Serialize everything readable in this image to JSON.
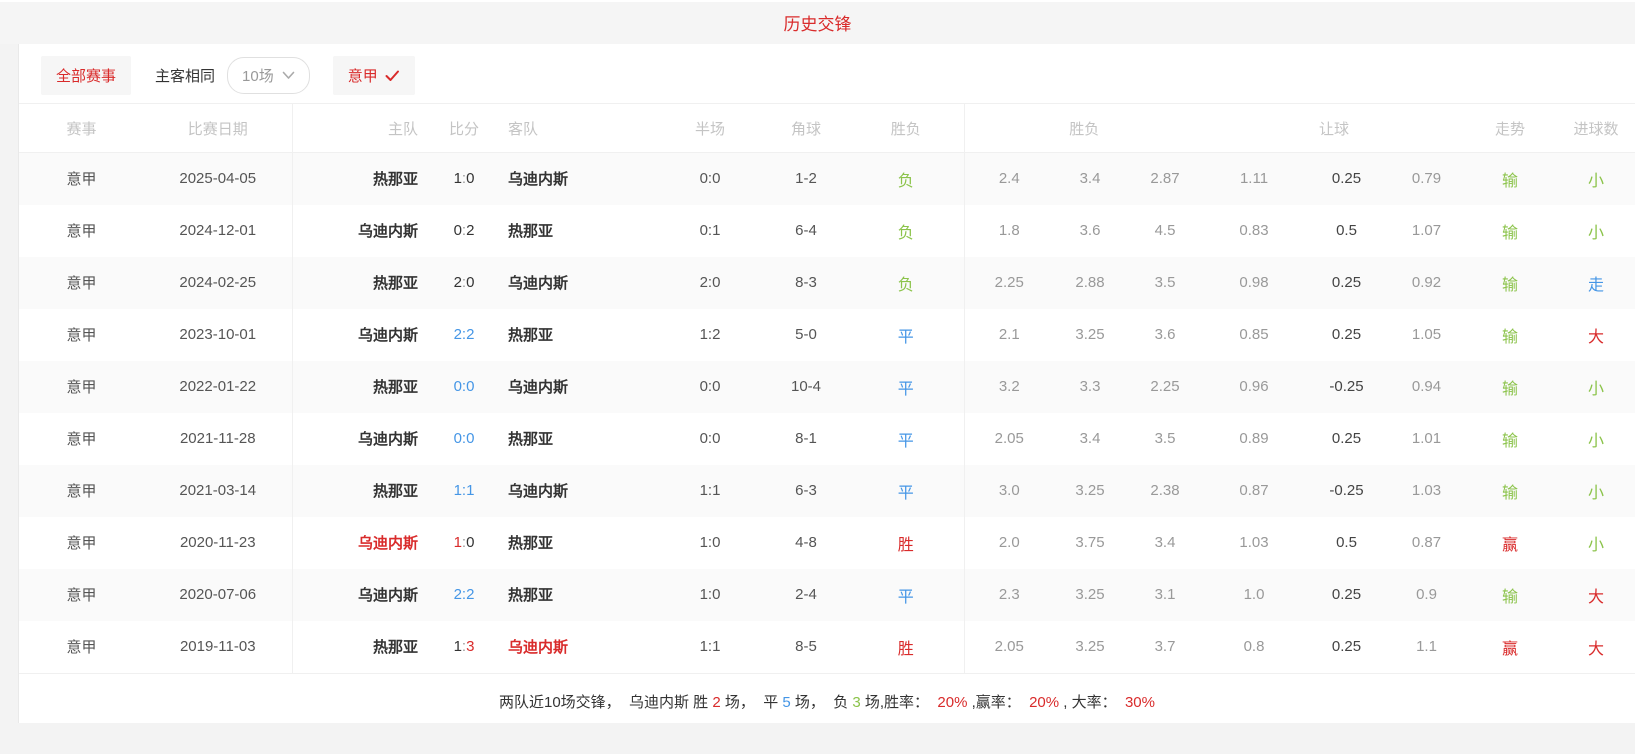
{
  "page": {
    "title": "历史交锋"
  },
  "colors": {
    "red": "#d92b2b",
    "blue": "#4596e6",
    "green": "#8bc34a",
    "band_bg": "#f5f5f5",
    "zebra_bg": "#fafafa"
  },
  "icons": {
    "league_check": "check-icon",
    "count_dropdown": "chevron-down-icon"
  },
  "filters": {
    "all_events": "全部赛事",
    "same_venue": "主客相同",
    "count_selected": "10场",
    "league": "意甲"
  },
  "table": {
    "headers": {
      "league": "赛事",
      "date": "比赛日期",
      "home": "主队",
      "score": "比分",
      "away": "客队",
      "half": "半场",
      "corner": "角球",
      "result": "胜负",
      "odds_group": "胜负",
      "handicap_group": "让球",
      "trend": "走势",
      "goals": "进球数"
    },
    "rows": [
      {
        "lg": "意甲",
        "date": "2025-04-05",
        "home": "热那亚",
        "home_c": "",
        "sh": "1",
        "sh_c": "c-dark",
        "colon_c": "c-gray",
        "sa": "0",
        "sa_c": "c-dark",
        "away": "乌迪内斯",
        "away_c": "",
        "half": "0:0",
        "corner": "1-2",
        "res": "负",
        "res_c": "c-green",
        "o1": "2.4",
        "o2": "3.4",
        "o3": "2.87",
        "h1": "1.11",
        "h2": "0.25",
        "h3": "0.79",
        "tr": "输",
        "tr_c": "c-green",
        "go": "小",
        "go_c": "c-green"
      },
      {
        "lg": "意甲",
        "date": "2024-12-01",
        "home": "乌迪内斯",
        "home_c": "",
        "sh": "0",
        "sh_c": "c-dark",
        "colon_c": "c-gray",
        "sa": "2",
        "sa_c": "c-dark",
        "away": "热那亚",
        "away_c": "",
        "half": "0:1",
        "corner": "6-4",
        "res": "负",
        "res_c": "c-green",
        "o1": "1.8",
        "o2": "3.6",
        "o3": "4.5",
        "h1": "0.83",
        "h2": "0.5",
        "h3": "1.07",
        "tr": "输",
        "tr_c": "c-green",
        "go": "小",
        "go_c": "c-green"
      },
      {
        "lg": "意甲",
        "date": "2024-02-25",
        "home": "热那亚",
        "home_c": "",
        "sh": "2",
        "sh_c": "c-dark",
        "colon_c": "c-gray",
        "sa": "0",
        "sa_c": "c-dark",
        "away": "乌迪内斯",
        "away_c": "",
        "half": "2:0",
        "corner": "8-3",
        "res": "负",
        "res_c": "c-green",
        "o1": "2.25",
        "o2": "2.88",
        "o3": "3.5",
        "h1": "0.98",
        "h2": "0.25",
        "h3": "0.92",
        "tr": "输",
        "tr_c": "c-green",
        "go": "走",
        "go_c": "c-blue"
      },
      {
        "lg": "意甲",
        "date": "2023-10-01",
        "home": "乌迪内斯",
        "home_c": "",
        "sh": "2",
        "sh_c": "c-blue",
        "colon_c": "c-blue",
        "sa": "2",
        "sa_c": "c-blue",
        "away": "热那亚",
        "away_c": "",
        "half": "1:2",
        "corner": "5-0",
        "res": "平",
        "res_c": "c-blue",
        "o1": "2.1",
        "o2": "3.25",
        "o3": "3.6",
        "h1": "0.85",
        "h2": "0.25",
        "h3": "1.05",
        "tr": "输",
        "tr_c": "c-green",
        "go": "大",
        "go_c": "c-red"
      },
      {
        "lg": "意甲",
        "date": "2022-01-22",
        "home": "热那亚",
        "home_c": "",
        "sh": "0",
        "sh_c": "c-blue",
        "colon_c": "c-blue",
        "sa": "0",
        "sa_c": "c-blue",
        "away": "乌迪内斯",
        "away_c": "",
        "half": "0:0",
        "corner": "10-4",
        "res": "平",
        "res_c": "c-blue",
        "o1": "3.2",
        "o2": "3.3",
        "o3": "2.25",
        "h1": "0.96",
        "h2": "-0.25",
        "h3": "0.94",
        "tr": "输",
        "tr_c": "c-green",
        "go": "小",
        "go_c": "c-green"
      },
      {
        "lg": "意甲",
        "date": "2021-11-28",
        "home": "乌迪内斯",
        "home_c": "",
        "sh": "0",
        "sh_c": "c-blue",
        "colon_c": "c-blue",
        "sa": "0",
        "sa_c": "c-blue",
        "away": "热那亚",
        "away_c": "",
        "half": "0:0",
        "corner": "8-1",
        "res": "平",
        "res_c": "c-blue",
        "o1": "2.05",
        "o2": "3.4",
        "o3": "3.5",
        "h1": "0.89",
        "h2": "0.25",
        "h3": "1.01",
        "tr": "输",
        "tr_c": "c-green",
        "go": "小",
        "go_c": "c-green"
      },
      {
        "lg": "意甲",
        "date": "2021-03-14",
        "home": "热那亚",
        "home_c": "",
        "sh": "1",
        "sh_c": "c-blue",
        "colon_c": "c-blue",
        "sa": "1",
        "sa_c": "c-blue",
        "away": "乌迪内斯",
        "away_c": "",
        "half": "1:1",
        "corner": "6-3",
        "res": "平",
        "res_c": "c-blue",
        "o1": "3.0",
        "o2": "3.25",
        "o3": "2.38",
        "h1": "0.87",
        "h2": "-0.25",
        "h3": "1.03",
        "tr": "输",
        "tr_c": "c-green",
        "go": "小",
        "go_c": "c-green"
      },
      {
        "lg": "意甲",
        "date": "2020-11-23",
        "home": "乌迪内斯",
        "home_c": "c-red",
        "sh": "1",
        "sh_c": "c-red",
        "colon_c": "c-gray",
        "sa": "0",
        "sa_c": "c-dark",
        "away": "热那亚",
        "away_c": "",
        "half": "1:0",
        "corner": "4-8",
        "res": "胜",
        "res_c": "c-red",
        "o1": "2.0",
        "o2": "3.75",
        "o3": "3.4",
        "h1": "1.03",
        "h2": "0.5",
        "h3": "0.87",
        "tr": "赢",
        "tr_c": "c-red",
        "go": "小",
        "go_c": "c-green"
      },
      {
        "lg": "意甲",
        "date": "2020-07-06",
        "home": "乌迪内斯",
        "home_c": "",
        "sh": "2",
        "sh_c": "c-blue",
        "colon_c": "c-blue",
        "sa": "2",
        "sa_c": "c-blue",
        "away": "热那亚",
        "away_c": "",
        "half": "1:0",
        "corner": "2-4",
        "res": "平",
        "res_c": "c-blue",
        "o1": "2.3",
        "o2": "3.25",
        "o3": "3.1",
        "h1": "1.0",
        "h2": "0.25",
        "h3": "0.9",
        "tr": "输",
        "tr_c": "c-green",
        "go": "大",
        "go_c": "c-red"
      },
      {
        "lg": "意甲",
        "date": "2019-11-03",
        "home": "热那亚",
        "home_c": "",
        "sh": "1",
        "sh_c": "c-dark",
        "colon_c": "c-gray",
        "sa": "3",
        "sa_c": "c-red",
        "away": "乌迪内斯",
        "away_c": "c-red",
        "half": "1:1",
        "corner": "8-5",
        "res": "胜",
        "res_c": "c-red",
        "o1": "2.05",
        "o2": "3.25",
        "o3": "3.7",
        "h1": "0.8",
        "h2": "0.25",
        "h3": "1.1",
        "tr": "赢",
        "tr_c": "c-red",
        "go": "大",
        "go_c": "c-red"
      }
    ]
  },
  "summary": {
    "parts": [
      {
        "text": "两队近10场交锋，  乌迪内斯 胜 ",
        "cls": ""
      },
      {
        "text": "2",
        "cls": "c-red"
      },
      {
        "text": " 场，  平 ",
        "cls": ""
      },
      {
        "text": "5",
        "cls": "c-blue"
      },
      {
        "text": " 场，  负 ",
        "cls": ""
      },
      {
        "text": "3",
        "cls": "c-green"
      },
      {
        "text": " 场,胜率：  ",
        "cls": ""
      },
      {
        "text": "20%",
        "cls": "c-red"
      },
      {
        "text": " ,赢率：  ",
        "cls": ""
      },
      {
        "text": "20%",
        "cls": "c-red"
      },
      {
        "text": " , 大率：  ",
        "cls": ""
      },
      {
        "text": "30%",
        "cls": "c-red"
      }
    ]
  }
}
